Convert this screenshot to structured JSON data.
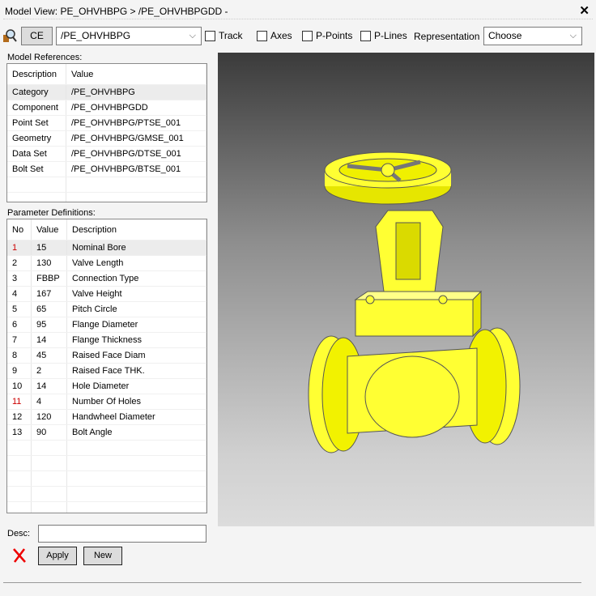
{
  "title": "Model View: PE_OHVHBPG > /PE_OHVHBPGDD -",
  "toolbar": {
    "ce_label": "CE",
    "element_value": "/PE_OHVHBPG",
    "track": "Track",
    "axes": "Axes",
    "ppoints": "P-Points",
    "plines": "P-Lines",
    "representation_label": "Representation",
    "representation_value": "Choose"
  },
  "model_references": {
    "label": "Model References:",
    "headers": [
      "Description",
      "Value"
    ],
    "rows": [
      [
        "Category",
        "/PE_OHVHBPG"
      ],
      [
        "Component",
        "/PE_OHVHBPGDD"
      ],
      [
        "Point Set",
        "/PE_OHVHBPG/PTSE_001"
      ],
      [
        "Geometry",
        "/PE_OHVHBPG/GMSE_001"
      ],
      [
        "Data Set",
        "/PE_OHVHBPG/DTSE_001"
      ],
      [
        "Bolt Set",
        "/PE_OHVHBPG/BTSE_001"
      ]
    ]
  },
  "parameters": {
    "label": "Parameter Definitions:",
    "headers": [
      "No",
      "Value",
      "Description"
    ],
    "rows": [
      [
        "1",
        "15",
        "Nominal Bore"
      ],
      [
        "2",
        "130",
        "Valve Length"
      ],
      [
        "3",
        "FBBP",
        "Connection Type"
      ],
      [
        "4",
        "167",
        "Valve Height"
      ],
      [
        "5",
        "65",
        "Pitch Circle"
      ],
      [
        "6",
        "95",
        "Flange Diameter"
      ],
      [
        "7",
        "14",
        "Flange Thickness"
      ],
      [
        "8",
        "45",
        "Raised Face Diam"
      ],
      [
        "9",
        "2",
        "Raised Face THK."
      ],
      [
        "10",
        "14",
        "Hole Diameter"
      ],
      [
        "11",
        "4",
        "Number Of Holes"
      ],
      [
        "12",
        "120",
        "Handwheel Diameter"
      ],
      [
        "13",
        "90",
        "Bolt Angle"
      ]
    ]
  },
  "form": {
    "desc_label": "Desc:",
    "desc_value": "",
    "apply": "Apply",
    "new": "New"
  },
  "colors": {
    "model": "#ffff33",
    "red_no": "#cc0000"
  }
}
